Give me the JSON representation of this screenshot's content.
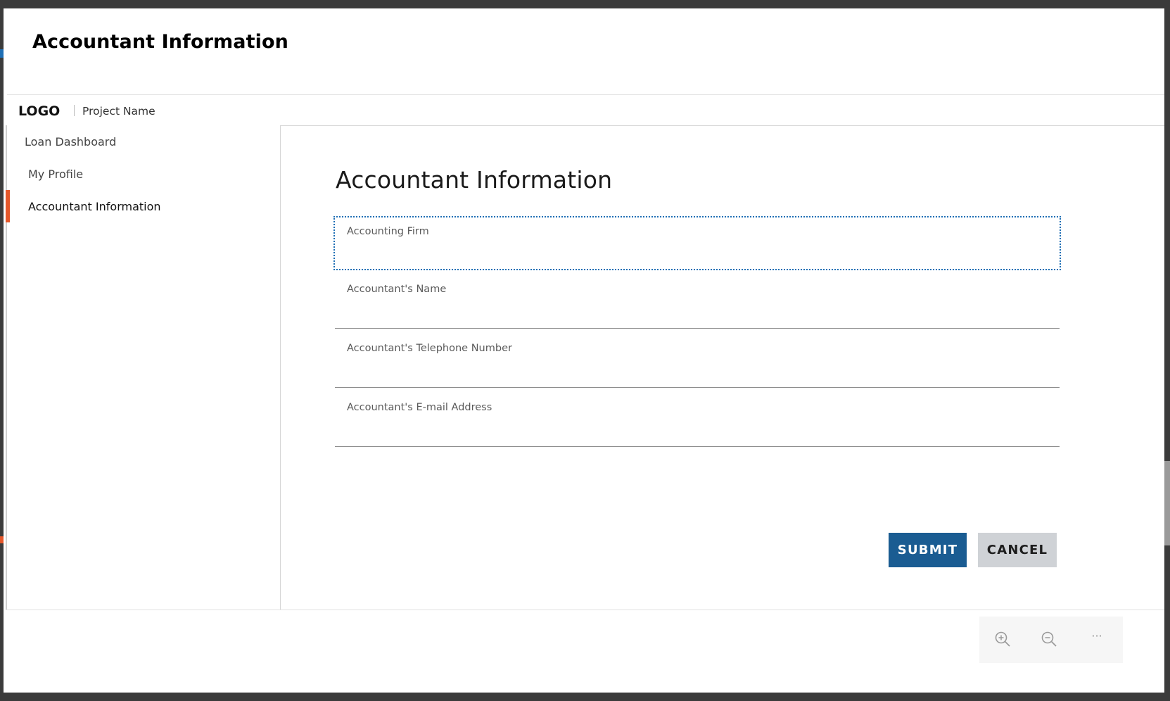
{
  "dialog": {
    "title": "Accountant Information"
  },
  "appbar": {
    "logo": "LOGO",
    "project_name": "Project Name"
  },
  "sidebar": {
    "items": [
      {
        "label": "Loan Dashboard",
        "active": false
      },
      {
        "label": "My Profile",
        "active": false
      },
      {
        "label": "Accountant Information",
        "active": true
      }
    ]
  },
  "main": {
    "title": "Accountant Information",
    "fields": [
      {
        "label": "Accounting Firm",
        "value": "",
        "focused": true
      },
      {
        "label": "Accountant's Name",
        "value": ""
      },
      {
        "label": "Accountant's Telephone Number",
        "value": ""
      },
      {
        "label": "Accountant's E-mail Address",
        "value": ""
      }
    ],
    "actions": {
      "submit_label": "SUBMIT",
      "cancel_label": "CANCEL"
    }
  },
  "zoom_toolbar": {
    "more_label": "···"
  },
  "colors": {
    "accent_active": "#e5572a",
    "primary_button": "#1a5c92",
    "secondary_button": "#cfd2d6",
    "focus_outline": "#1f6fb5"
  }
}
